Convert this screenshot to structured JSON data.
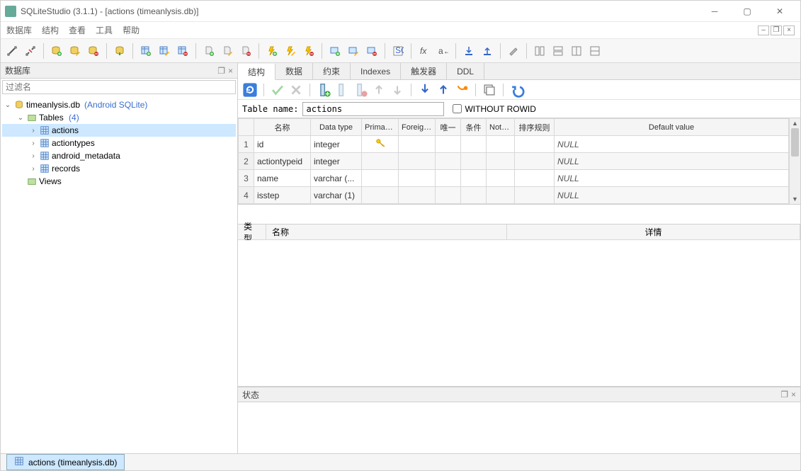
{
  "window": {
    "title": "SQLiteStudio (3.1.1) - [actions (timeanlysis.db)]"
  },
  "menu": [
    "数据库",
    "结构",
    "查看",
    "工具",
    "帮助"
  ],
  "sidebar": {
    "title": "数据库",
    "filter_placeholder": "过滤名",
    "db_name": "timeanlysis.db",
    "db_type": "(Android SQLite)",
    "tables_label": "Tables",
    "tables_count": "(4)",
    "tables": [
      "actions",
      "actiontypes",
      "android_metadata",
      "records"
    ],
    "views_label": "Views"
  },
  "tabs": [
    "结构",
    "数据",
    "约束",
    "Indexes",
    "触发器",
    "DDL"
  ],
  "tablename_label": "Table name:",
  "tablename_value": "actions",
  "without_rowid_label": "WITHOUT ROWID",
  "columns_header": [
    "名称",
    "Data type",
    "Primary Key",
    "Foreign Key",
    "唯一",
    "条件",
    "Not NULL",
    "排序规则",
    "Default value"
  ],
  "columns": [
    {
      "n": "1",
      "name": "id",
      "type": "integer",
      "pk": true,
      "def": "NULL"
    },
    {
      "n": "2",
      "name": "actiontypeid",
      "type": "integer",
      "pk": false,
      "def": "NULL"
    },
    {
      "n": "3",
      "name": "name",
      "type": "varchar (...",
      "pk": false,
      "def": "NULL"
    },
    {
      "n": "4",
      "name": "isstep",
      "type": "varchar (1)",
      "pk": false,
      "def": "NULL"
    }
  ],
  "detail_header": [
    "类型",
    "名称",
    "详情"
  ],
  "status_title": "状态",
  "doc_tab_label": "actions (timeanlysis.db)"
}
